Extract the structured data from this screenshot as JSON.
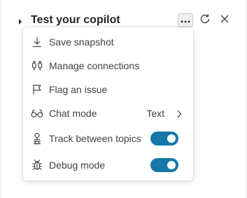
{
  "header": {
    "title": "Test your copilot",
    "icons": [
      "caret-right-icon",
      "more-icon",
      "refresh-icon",
      "close-icon"
    ]
  },
  "menu": {
    "items": [
      {
        "label": "Save snapshot",
        "icon": "download-icon"
      },
      {
        "label": "Manage connections",
        "icon": "plug-connected-icon"
      },
      {
        "label": "Flag an issue",
        "icon": "flag-icon"
      },
      {
        "label": "Chat mode",
        "icon": "glasses-icon",
        "value": "Text"
      },
      {
        "label": "Track between topics",
        "icon": "topic-tracking-icon",
        "toggle": true
      },
      {
        "label": "Debug mode",
        "icon": "bug-icon",
        "toggle": true
      }
    ]
  },
  "colors": {
    "toggle_on": "#1477a8",
    "text": "#242424"
  }
}
